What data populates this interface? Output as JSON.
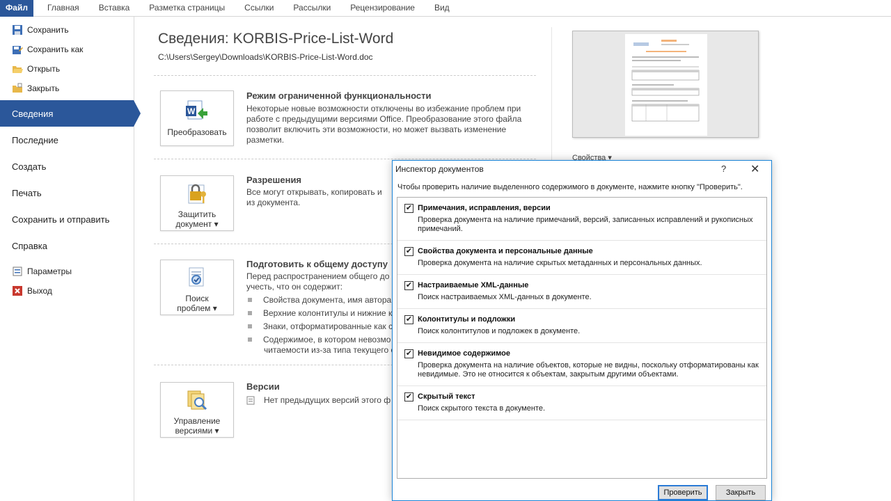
{
  "ribbon": {
    "tabs": [
      "Файл",
      "Главная",
      "Вставка",
      "Разметка страницы",
      "Ссылки",
      "Рассылки",
      "Рецензирование",
      "Вид"
    ]
  },
  "sidebar": {
    "small_items": [
      {
        "label": "Сохранить",
        "icon": "save-icon"
      },
      {
        "label": "Сохранить как",
        "icon": "save-as-icon"
      },
      {
        "label": "Открыть",
        "icon": "open-folder-icon"
      },
      {
        "label": "Закрыть",
        "icon": "close-folder-icon"
      }
    ],
    "big_items": [
      "Сведения",
      "Последние",
      "Создать",
      "Печать",
      "Сохранить и отправить",
      "Справка"
    ],
    "bottom_items": [
      {
        "label": "Параметры",
        "icon": "options-icon"
      },
      {
        "label": "Выход",
        "icon": "exit-icon"
      }
    ]
  },
  "info": {
    "title": "Сведения: KORBIS-Price-List-Word",
    "path": "C:\\Users\\Sergey\\Downloads\\KORBIS-Price-List-Word.doc",
    "convert": {
      "button": "Преобразовать",
      "heading": "Режим ограниченной функциональности",
      "text": "Некоторые новые возможности отключены во избежание проблем при работе с предыдущими версиями Office. Преобразование этого файла позволит включить эти возможности, но может вызвать изменение разметки."
    },
    "permissions": {
      "button_line1": "Защитить",
      "button_line2": "документ ▾",
      "heading": "Разрешения",
      "text": "Все могут открывать, копировать и из документа."
    },
    "prepare": {
      "button_line1": "Поиск",
      "button_line2": "проблем ▾",
      "heading": "Подготовить к общему доступу",
      "text_line1": "Перед распространением общего до",
      "text_line2": "учесть, что он содержит:",
      "bullets": [
        "Свойства документа, имя автора",
        "Верхние колонтитулы и нижние к",
        "Знаки, отформатированные как с",
        "Содержимое, в котором невозмо"
      ],
      "bullet_tail": "читаемости из-за типа текущего о"
    },
    "versions": {
      "button_line1": "Управление",
      "button_line2": "версиями ▾",
      "heading": "Версии",
      "text": "Нет предыдущих версий этого ф"
    },
    "properties_label": "Свойства ▾"
  },
  "dialog": {
    "title": "Инспектор документов",
    "help": "?",
    "close_glyph": "✕",
    "intro": "Чтобы проверить наличие выделенного содержимого в документе, нажмите кнопку \"Проверить\".",
    "items": [
      {
        "heading": "Примечания, исправления, версии",
        "desc": "Проверка документа на наличие примечаний, версий, записанных исправлений и рукописных примечаний.",
        "checked": true
      },
      {
        "heading": "Свойства документа и персональные данные",
        "desc": "Проверка документа на наличие скрытых метаданных и персональных данных.",
        "checked": true
      },
      {
        "heading": "Настраиваемые XML-данные",
        "desc": "Поиск настраиваемых XML-данных в документе.",
        "checked": true
      },
      {
        "heading": "Колонтитулы и подложки",
        "desc": "Поиск колонтитулов и подложек в документе.",
        "checked": true
      },
      {
        "heading": "Невидимое содержимое",
        "desc": "Проверка документа на наличие объектов, которые не видны, поскольку отформатированы как невидимые. Это не относится к объектам, закрытым другими объектами.",
        "checked": true
      },
      {
        "heading": "Скрытый текст",
        "desc": "Поиск скрытого текста в документе.",
        "checked": true
      }
    ],
    "check_mark": "✔",
    "check_button": "Проверить",
    "close_button": "Закрыть"
  },
  "colors": {
    "accent": "#2b579a",
    "dialog_border": "#1883d7"
  }
}
